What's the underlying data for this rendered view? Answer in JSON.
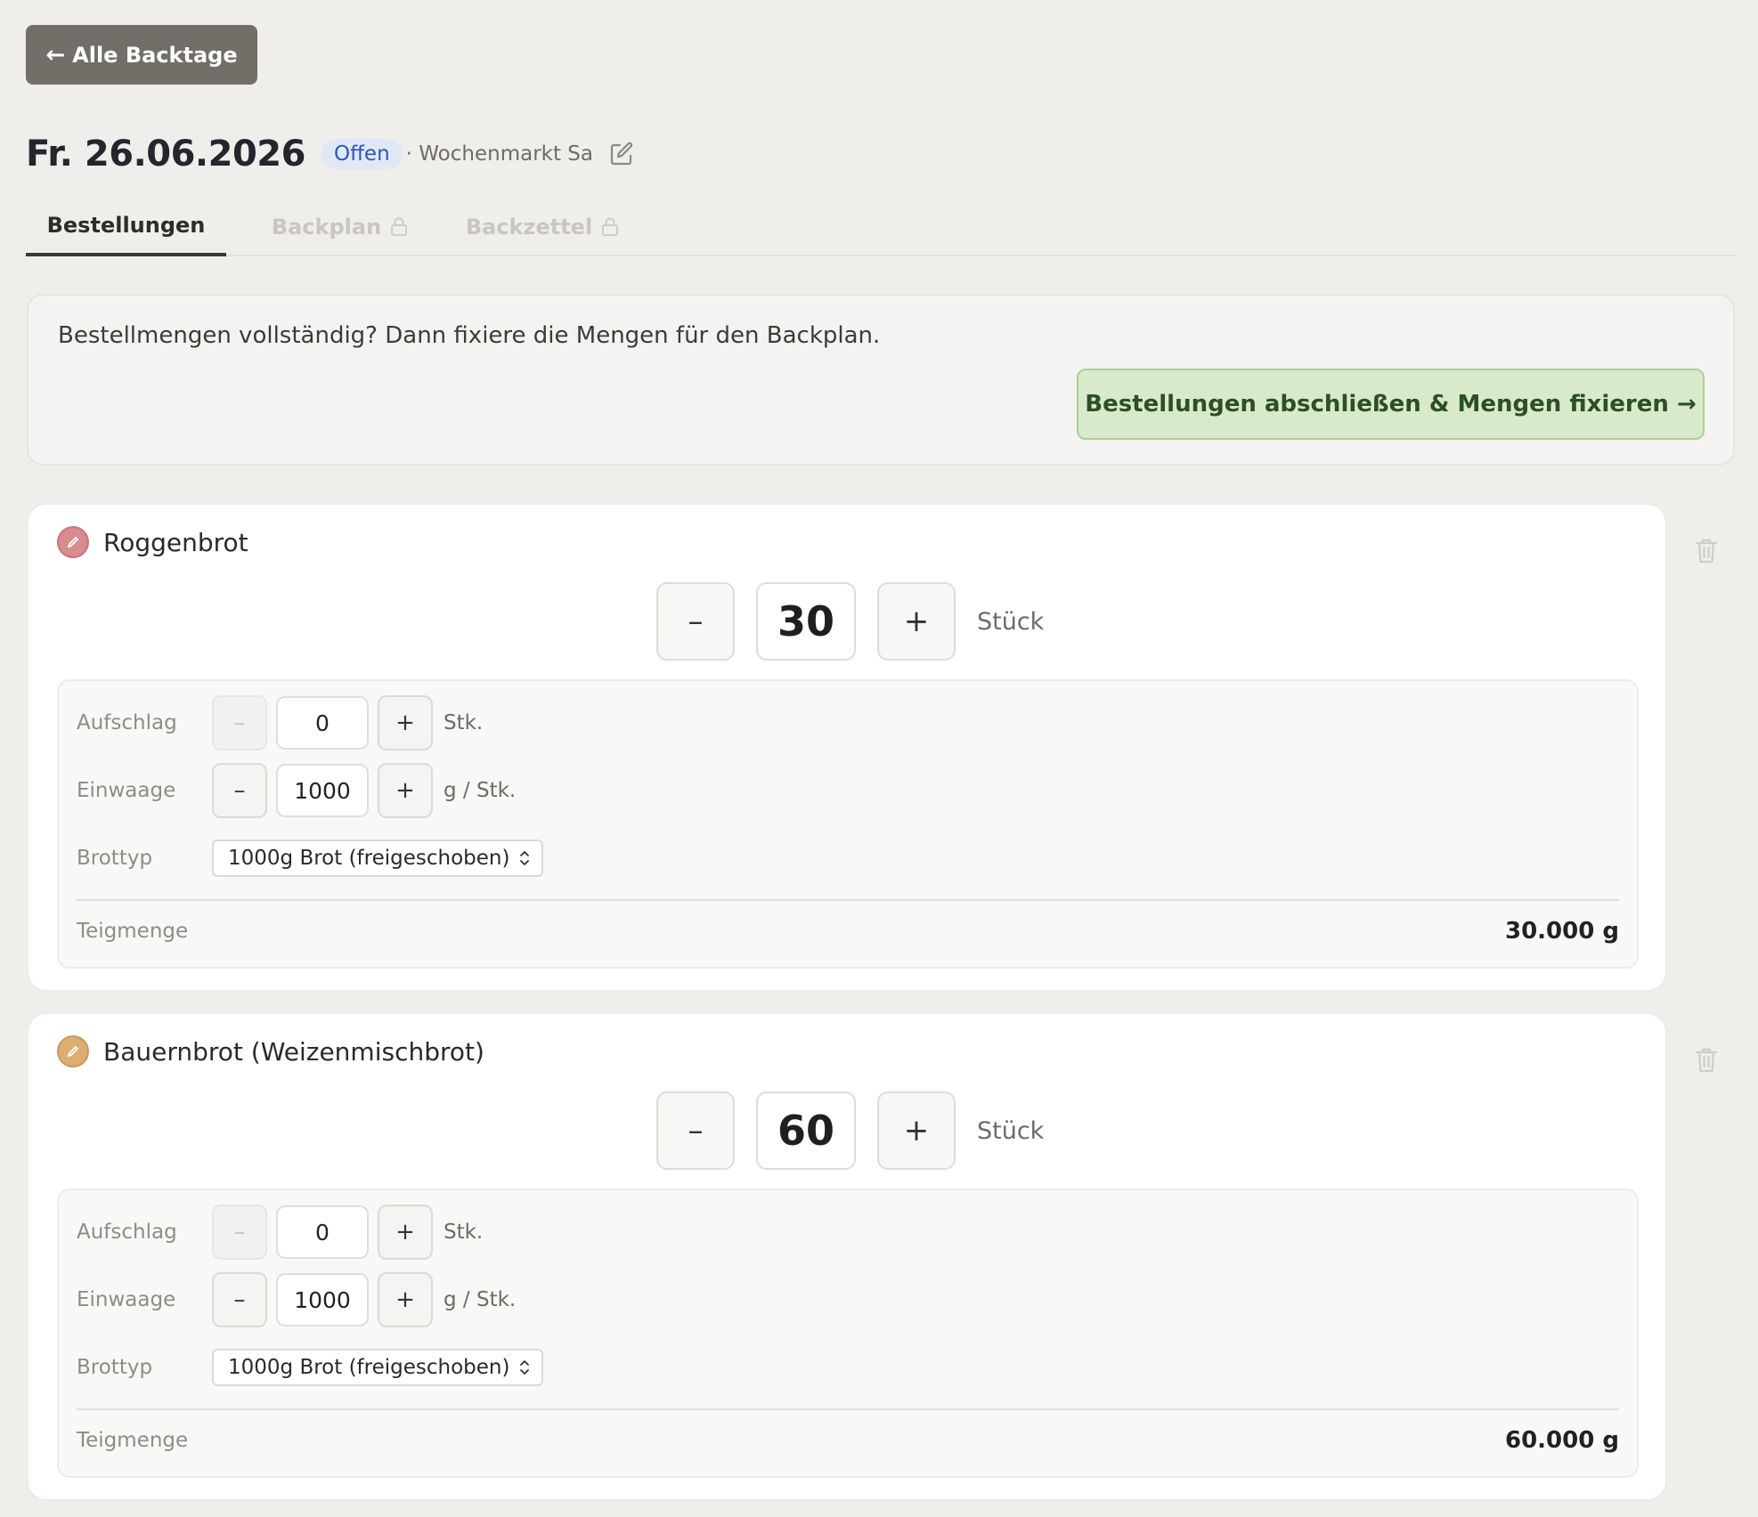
{
  "nav": {
    "back_label": "Alle Backtage"
  },
  "header": {
    "date": "Fr. 26.06.2026",
    "status": "Offen",
    "location": "· Wochenmarkt Sa"
  },
  "tabs": [
    {
      "label": "Bestellungen",
      "active": true,
      "locked": false
    },
    {
      "label": "Backplan",
      "active": false,
      "locked": true
    },
    {
      "label": "Backzettel",
      "active": false,
      "locked": true
    }
  ],
  "notice": {
    "text": "Bestellmengen vollständig? Dann fixiere die Mengen für den Backplan.",
    "button_label": "Bestellungen abschließen & Mengen fixieren →"
  },
  "labels": {
    "qty_unit": "Stück",
    "surcharge": "Aufschlag",
    "surcharge_unit": "Stk.",
    "weight": "Einwaage",
    "weight_unit": "g / Stk.",
    "bread_type": "Brottyp",
    "dough_amount": "Teigmenge",
    "minus": "–",
    "plus": "+"
  },
  "products": [
    {
      "name": "Roggenbrot",
      "color": "#d98a8e",
      "quantity": "30",
      "surcharge": "0",
      "weight": "1000",
      "bread_type": "1000g Brot (freigeschoben)",
      "dough_amount": "30.000 g"
    },
    {
      "name": "Bauernbrot (Weizenmischbrot)",
      "color": "#dcae72",
      "quantity": "60",
      "surcharge": "0",
      "weight": "1000",
      "bread_type": "1000g Brot (freigeschoben)",
      "dough_amount": "60.000 g"
    }
  ]
}
